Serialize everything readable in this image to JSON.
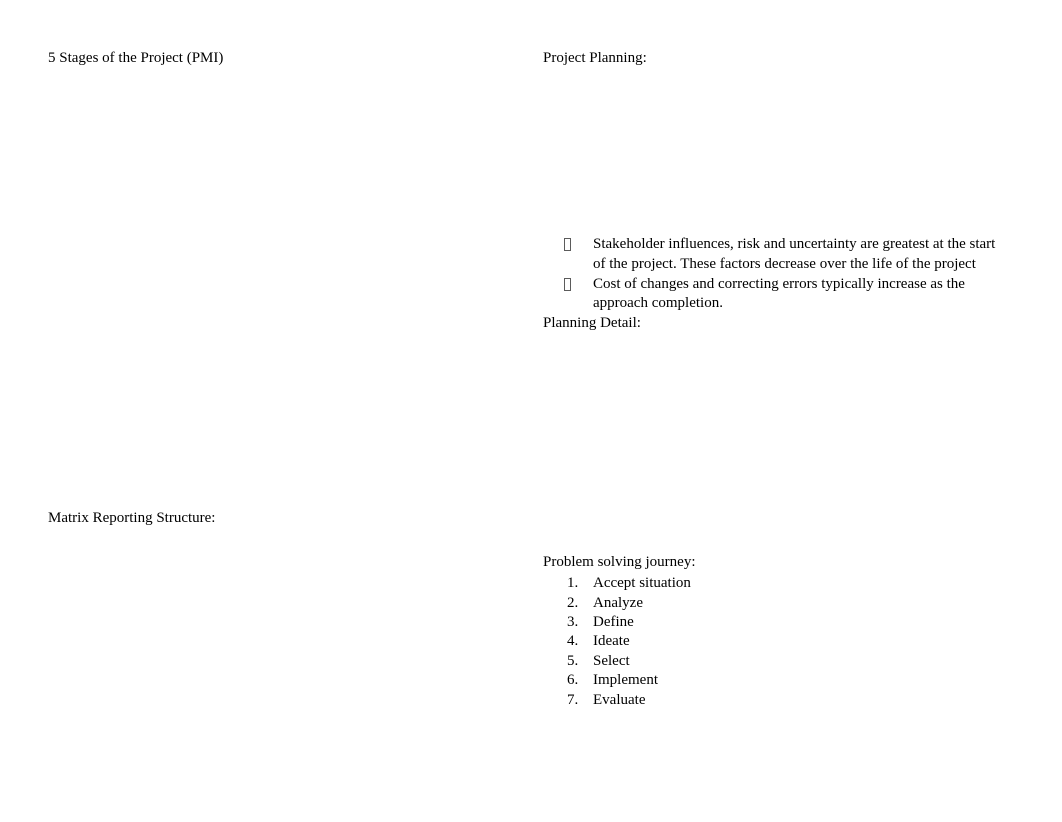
{
  "document": {
    "page_background": "#ffffff",
    "text_color": "#000000"
  },
  "left_column": {
    "headings": [
      {
        "text": "5 Stages of the Project (PMI)"
      },
      {
        "text": "Matrix Reporting Structure:"
      }
    ]
  },
  "right_column": {
    "project_planning": {
      "heading": "Project Planning:",
      "bullet_marker": "missing-glyph-box",
      "bullets": [
        "Stakeholder influences, risk and uncertainty are greatest at the start of the project. These factors decrease over the life of the project",
        "Cost of changes and correcting errors typically increase as the approach completion."
      ]
    },
    "planning_detail": {
      "heading": "Planning Detail:"
    },
    "problem_solving": {
      "heading": "Problem solving journey:",
      "steps": [
        {
          "number": "1.",
          "label": "Accept situation"
        },
        {
          "number": "2.",
          "label": "Analyze"
        },
        {
          "number": "3.",
          "label": "Define"
        },
        {
          "number": "4.",
          "label": "Ideate"
        },
        {
          "number": "5.",
          "label": "Select"
        },
        {
          "number": "6.",
          "label": "Implement"
        },
        {
          "number": "7.",
          "label": "Evaluate"
        }
      ]
    }
  }
}
